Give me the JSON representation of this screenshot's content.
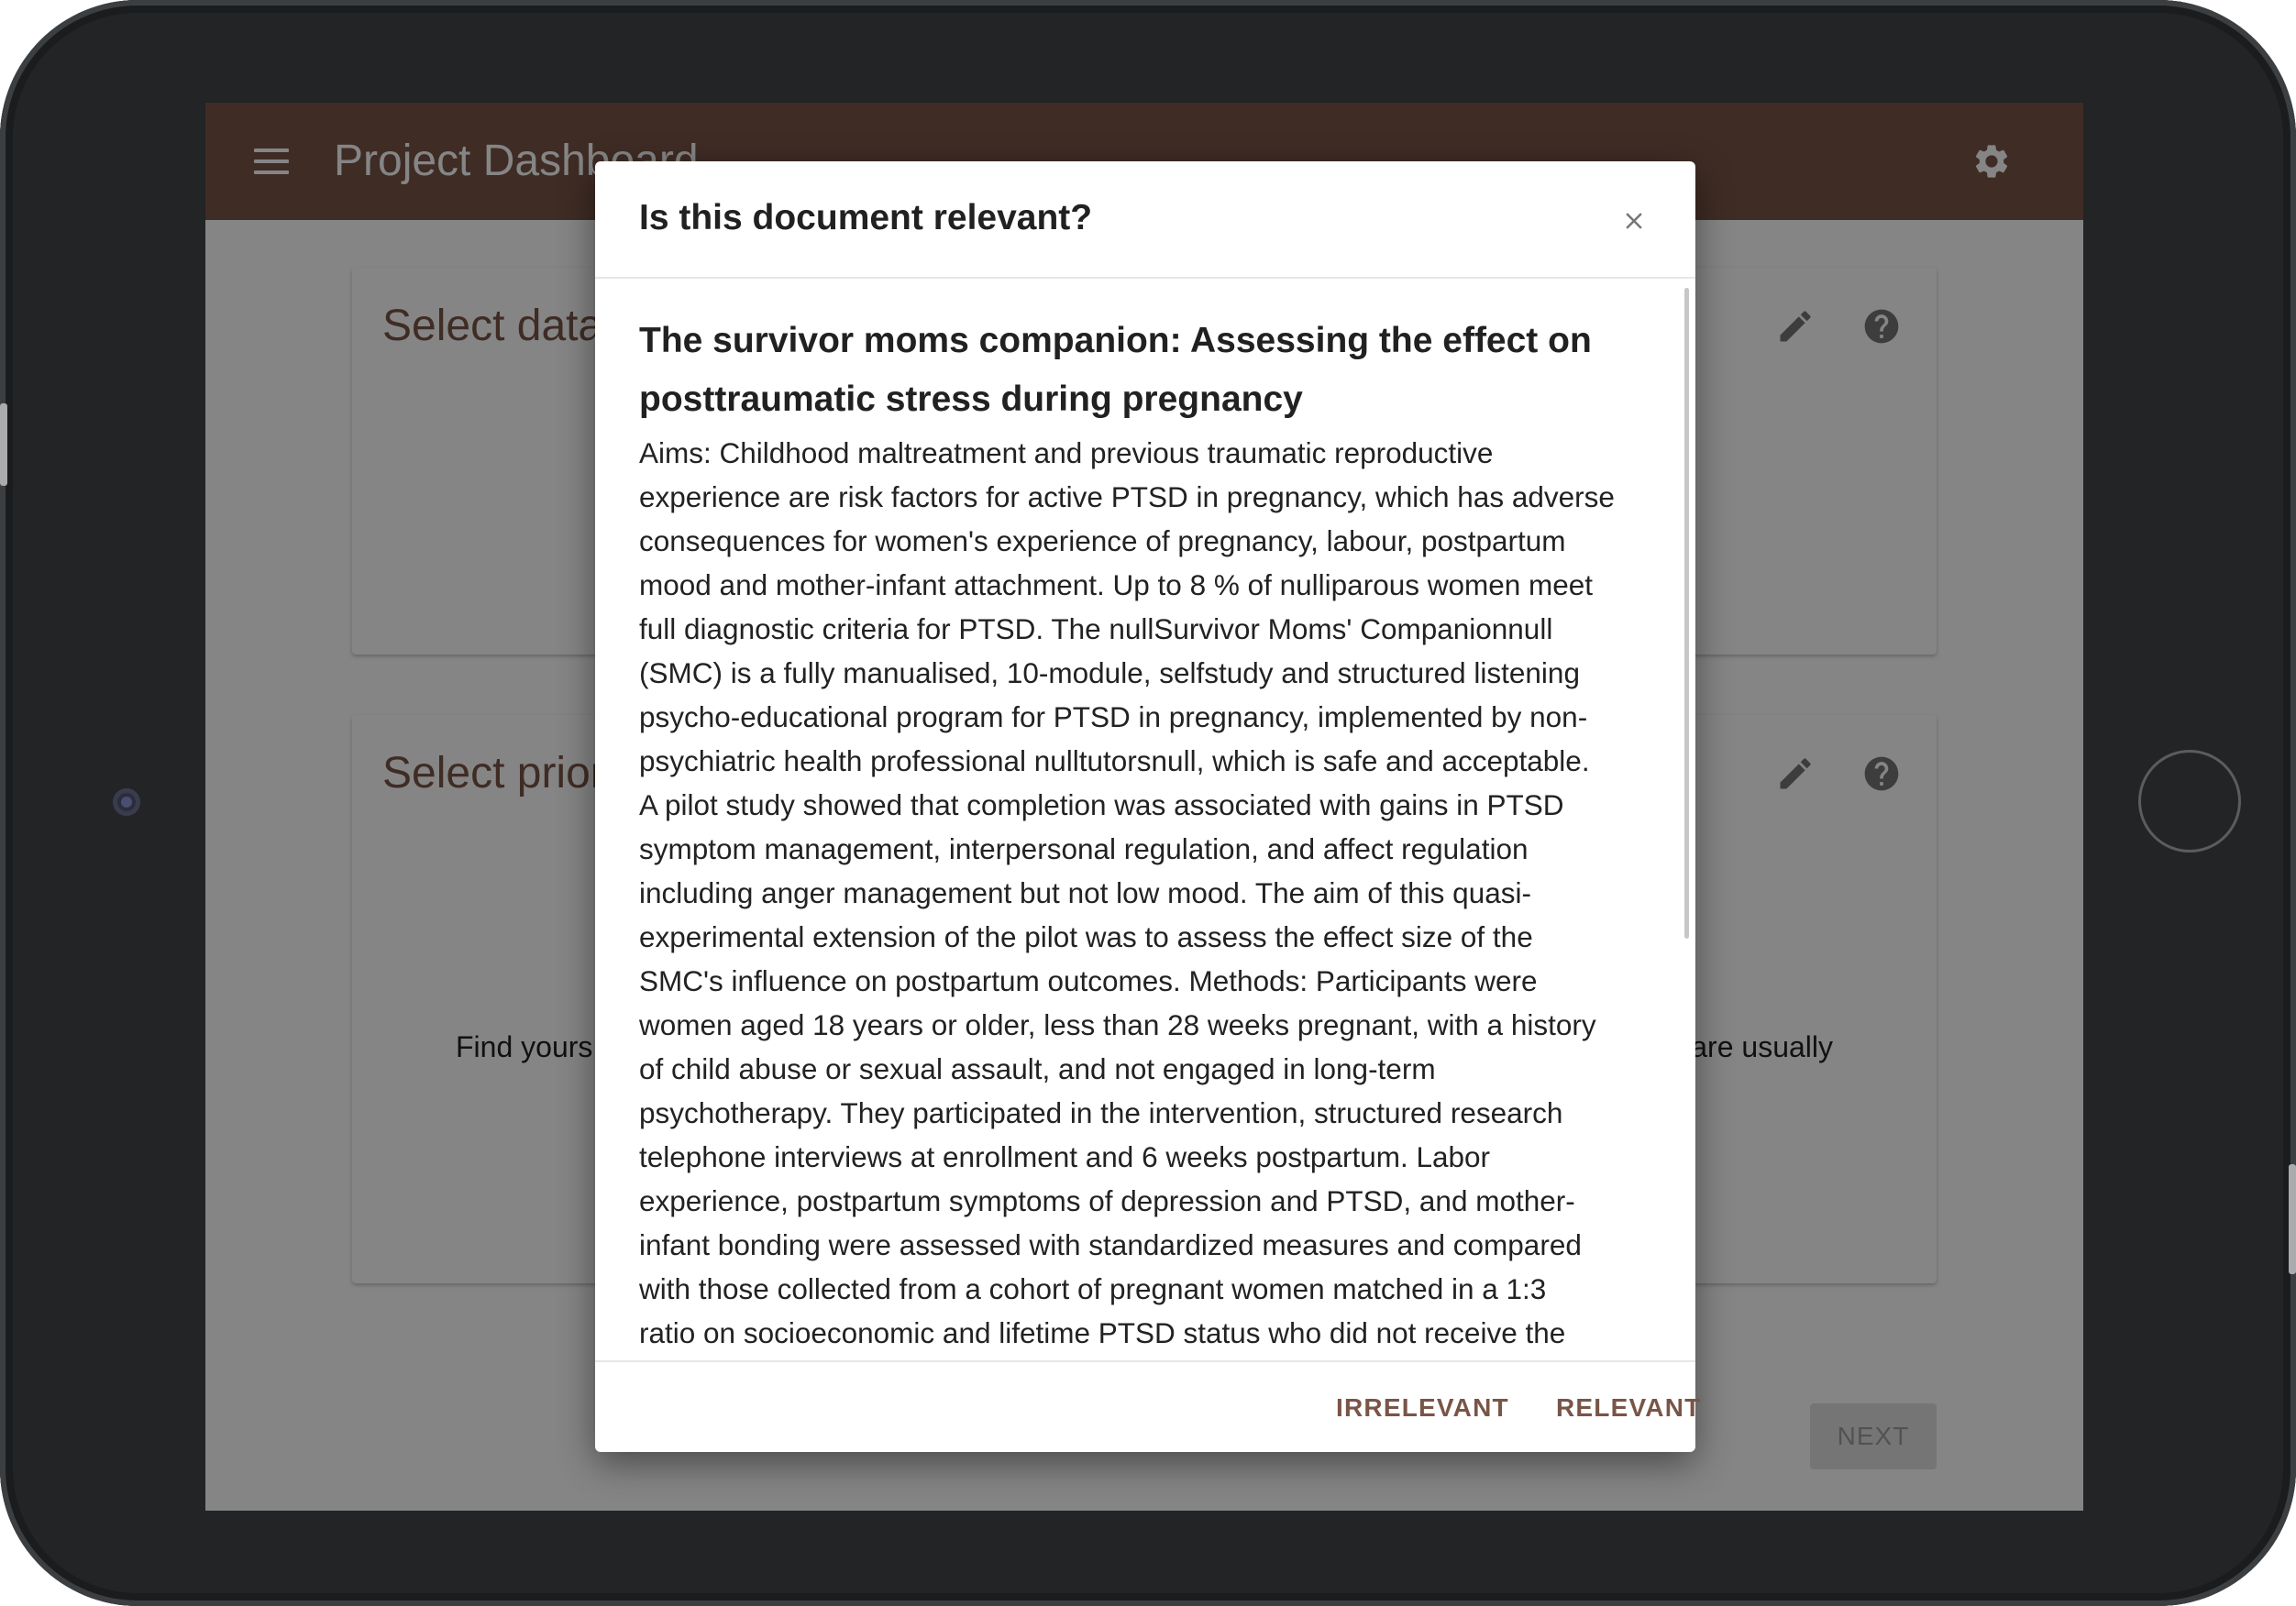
{
  "app": {
    "title": "Project Dashboard"
  },
  "icons": {
    "menu": "menu-icon",
    "settings": "gear-icon",
    "edit": "pencil-icon",
    "help": "help-icon",
    "close": "close-icon"
  },
  "colors": {
    "primary": "#795548",
    "scrim": "rgba(0,0,0,0.48)",
    "disabled": "#9e9e9e"
  },
  "cards": [
    {
      "title": "Select dataset"
    },
    {
      "title": "Select prior knowledge",
      "text_left": "Find yours",
      "text_right": "are usually"
    }
  ],
  "next_button": {
    "label": "NEXT",
    "disabled": true
  },
  "dialog": {
    "title": "Is this document relevant?",
    "document": {
      "title": "The survivor moms companion: Assessing the effect on posttraumatic stress during pregnancy",
      "abstract_lines": [
        "Aims: Childhood maltreatment and previous traumatic reproductive",
        "experience are risk factors for active PTSD in pregnancy, which has adverse",
        "consequences for women's experience of pregnancy, labour, postpartum",
        "mood and mother-infant attachment. Up to 8 % of nulliparous women meet",
        "full diagnostic criteria for PTSD. The nullSurvivor Moms' Companionnull",
        "(SMC) is a fully manualised, 10-module, selfstudy and structured listening",
        "psycho-educational program for PTSD in pregnancy, implemented by non-",
        "psychiatric health professional nulltutorsnull, which is safe and acceptable.",
        "A pilot study showed that completion was associated with gains in PTSD",
        "symptom management, interpersonal regulation, and affect regulation",
        "including anger management but not low mood. The aim of this quasi-",
        "experimental extension of the pilot was to assess the effect size of the",
        "SMC's influence on postpartum outcomes. Methods: Participants were",
        "women aged 18 years or older, less than 28 weeks pregnant, with a history",
        "of child abuse or sexual assault, and not engaged in long-term",
        "psychotherapy. They participated in the intervention, structured research",
        "telephone interviews at enrollment and 6 weeks postpartum. Labor",
        "experience, postpartum symptoms of depression and PTSD, and mother-",
        "infant bonding were assessed with standardized measures and compared",
        "with those collected from a cohort of pregnant women matched in a 1:3",
        "ratio on socioeconomic and lifetime PTSD status who did not receive the"
      ]
    },
    "buttons": {
      "irrelevant": "IRRELEVANT",
      "relevant": "RELEVANT"
    }
  }
}
